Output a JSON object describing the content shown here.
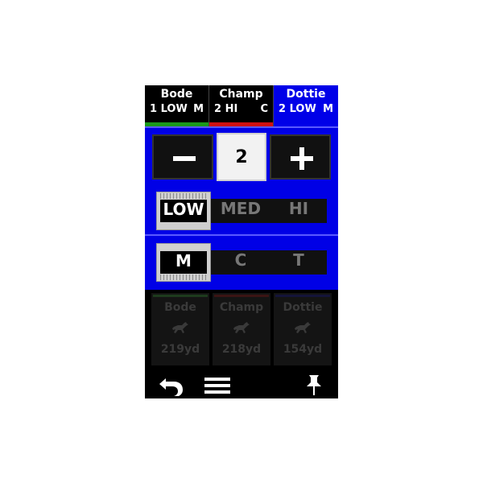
{
  "tabs": [
    {
      "name": "Bode",
      "count": "1",
      "level": "LOW",
      "mode": "M",
      "bar_color": "#1a9a1a"
    },
    {
      "name": "Champ",
      "count": "2",
      "level": "HI",
      "mode": "C",
      "bar_color": "#d01010"
    },
    {
      "name": "Dottie",
      "count": "2",
      "level": "LOW",
      "mode": "M",
      "bar_color": "#0000e8"
    }
  ],
  "active_tab": "Dottie",
  "stepper": {
    "value": "2",
    "minus_icon": "minus-icon",
    "plus_icon": "plus-icon"
  },
  "level": {
    "options": [
      "LOW",
      "MED",
      "HI"
    ],
    "selected": "LOW"
  },
  "mode": {
    "options": [
      "M",
      "C",
      "T"
    ],
    "selected": "M"
  },
  "dogs": [
    {
      "name": "Bode",
      "distance": "219yd",
      "color": "#1d3a1d",
      "icon": "dog-running-icon"
    },
    {
      "name": "Champ",
      "distance": "218yd",
      "color": "#3a1414",
      "icon": "dog-running-icon"
    },
    {
      "name": "Dottie",
      "distance": "154yd",
      "color": "#14143a",
      "icon": "dog-running-icon"
    }
  ],
  "toolbar": {
    "back_icon": "back-arrow-icon",
    "menu_icon": "menu-icon",
    "pin_icon": "pushpin-icon"
  },
  "colors": {
    "panel": "#0000e6",
    "background": "#000000",
    "card": "#141414",
    "card_text": "#3a3a3a"
  }
}
